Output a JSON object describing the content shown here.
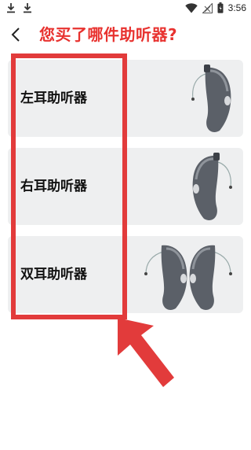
{
  "status": {
    "time": "3:56"
  },
  "header": {
    "title": "您买了哪件助听器?"
  },
  "options": [
    {
      "label": "左耳助听器"
    },
    {
      "label": "右耳助听器"
    },
    {
      "label": "双耳助听器"
    }
  ],
  "colors": {
    "title": "#e8322f",
    "highlight": "#e23b3b",
    "card": "#eeeff0"
  },
  "icons": [
    "download-icon",
    "wifi-icon",
    "signal-icon",
    "battery-icon",
    "back-arrow-icon",
    "hearing-aid-icon",
    "red-arrow-annotation"
  ]
}
